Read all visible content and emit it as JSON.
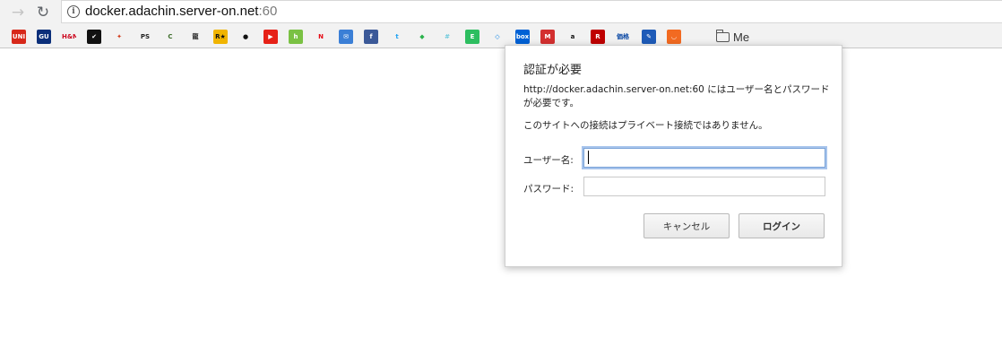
{
  "browser": {
    "back_icon": "arrow-left-icon",
    "reload_icon": "reload-icon",
    "info_icon": "info-circle-icon",
    "url_host": "docker.adachin.server-on.net",
    "url_port": ":60"
  },
  "bookmarks": [
    {
      "name": "UNIQLO",
      "text": "UNI QLO",
      "bg": "#d7281a",
      "fg": "#ffffff"
    },
    {
      "name": "GU",
      "text": "GU",
      "bg": "#0b2f7a",
      "fg": "#ffffff"
    },
    {
      "name": "H&M",
      "text": "H&M",
      "bg": "#f2f2f2",
      "fg": "#cc071e"
    },
    {
      "name": "Nike",
      "text": "✔",
      "bg": "#111111",
      "fg": "#ffffff"
    },
    {
      "name": "Mario",
      "text": "✦",
      "bg": "#f2f2f2",
      "fg": "#d13a1a"
    },
    {
      "name": "PlayStation",
      "text": "PS",
      "bg": "#f2f2f2",
      "fg": "#222222"
    },
    {
      "name": "C",
      "text": "C",
      "bg": "#f2f2f2",
      "fg": "#3d6d2a"
    },
    {
      "name": "龍",
      "text": "龍",
      "bg": "#f2f2f2",
      "fg": "#222222"
    },
    {
      "name": "Rockstar",
      "text": "R★",
      "bg": "#f0b400",
      "fg": "#111111"
    },
    {
      "name": "Bug",
      "text": "●",
      "bg": "#f2f2f2",
      "fg": "#111111"
    },
    {
      "name": "YouTube",
      "text": "▶",
      "bg": "#e62117",
      "fg": "#ffffff"
    },
    {
      "name": "Houzz",
      "text": "h",
      "bg": "#7ac143",
      "fg": "#ffffff"
    },
    {
      "name": "Netflix",
      "text": "N",
      "bg": "#f2f2f2",
      "fg": "#e50914"
    },
    {
      "name": "Mail",
      "text": "✉",
      "bg": "#3b7fd6",
      "fg": "#ffffff"
    },
    {
      "name": "Facebook",
      "text": "f",
      "bg": "#3b5998",
      "fg": "#ffffff"
    },
    {
      "name": "Twitter",
      "text": "t",
      "bg": "#f2f2f2",
      "fg": "#1da1f2"
    },
    {
      "name": "Feedly",
      "text": "◆",
      "bg": "#f2f2f2",
      "fg": "#2bb24c"
    },
    {
      "name": "Slack",
      "text": "#",
      "bg": "#f2f2f2",
      "fg": "#6ecadc"
    },
    {
      "name": "Evernote",
      "text": "E",
      "bg": "#2dbe60",
      "fg": "#ffffff"
    },
    {
      "name": "Dropbox",
      "text": "◇",
      "bg": "#f2f2f2",
      "fg": "#007ee5"
    },
    {
      "name": "Box",
      "text": "box",
      "bg": "#0061d5",
      "fg": "#ffffff"
    },
    {
      "name": "M",
      "text": "M",
      "bg": "#d32f2f",
      "fg": "#ffffff"
    },
    {
      "name": "Amazon",
      "text": "a",
      "bg": "#f2f2f2",
      "fg": "#111111"
    },
    {
      "name": "Rakuten",
      "text": "R",
      "bg": "#bf0000",
      "fg": "#ffffff"
    },
    {
      "name": "Kakaku",
      "text": "価格",
      "bg": "#f2f2f2",
      "fg": "#0d4aa5"
    },
    {
      "name": "Pen",
      "text": "✎",
      "bg": "#1e5bb8",
      "fg": "#ffffff"
    },
    {
      "name": "Smile",
      "text": "◡",
      "bg": "#f26a21",
      "fg": "#ffffff"
    }
  ],
  "bookmark_folder": {
    "label": "Me",
    "icon": "folder-icon"
  },
  "dialog": {
    "title": "認証が必要",
    "message": "http://docker.adachin.server-on.net:60 にはユーザー名とパスワードが必要です。",
    "note": "このサイトへの接続はプライベート接続ではありません。",
    "username_label": "ユーザー名:",
    "password_label": "パスワード:",
    "username_value": "",
    "password_value": "",
    "cancel_label": "キャンセル",
    "login_label": "ログイン"
  }
}
